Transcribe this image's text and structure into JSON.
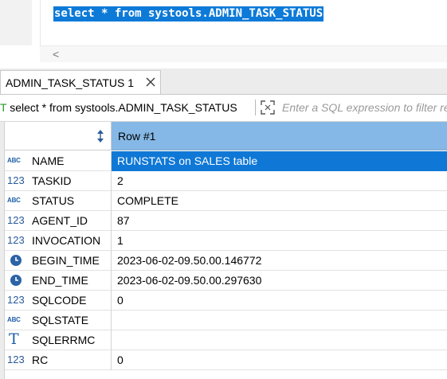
{
  "editor": {
    "sql_line": "select * from systools.ADMIN_TASK_STATUS",
    "scroll_left_glyph": "<"
  },
  "results_tab": {
    "label": "ADMIN_TASK_STATUS 1",
    "close_icon": "close-icon"
  },
  "filter_bar": {
    "prefix": "T",
    "query_text": "select * from systools.ADMIN_TASK_STATUS",
    "placeholder": "Enter a SQL expression to filter results (use Ctrl+Space)"
  },
  "grid": {
    "header_label": "Row #1",
    "rows": [
      {
        "type": "ABC",
        "name": "NAME",
        "value": "RUNSTATS on SALES table",
        "selected": true
      },
      {
        "type": "123",
        "name": "TASKID",
        "value": "2"
      },
      {
        "type": "ABC",
        "name": "STATUS",
        "value": "COMPLETE"
      },
      {
        "type": "123",
        "name": "AGENT_ID",
        "value": "87"
      },
      {
        "type": "123",
        "name": "INVOCATION",
        "value": "1"
      },
      {
        "type": "clock",
        "name": "BEGIN_TIME",
        "value": "2023-06-02-09.50.00.146772"
      },
      {
        "type": "clock",
        "name": "END_TIME",
        "value": "2023-06-02-09.50.00.297630"
      },
      {
        "type": "123",
        "name": "SQLCODE",
        "value": "0"
      },
      {
        "type": "ABC",
        "name": "SQLSTATE",
        "value": ""
      },
      {
        "type": "T",
        "name": "SQLERRMC",
        "value": ""
      },
      {
        "type": "123",
        "name": "RC",
        "value": "0"
      }
    ]
  },
  "colors": {
    "selection_blue": "#0f78d6",
    "header_blue": "#85b8e6",
    "filter_mark_green": "#2b9a2b",
    "type_icon_blue": "#1f5fa8"
  }
}
